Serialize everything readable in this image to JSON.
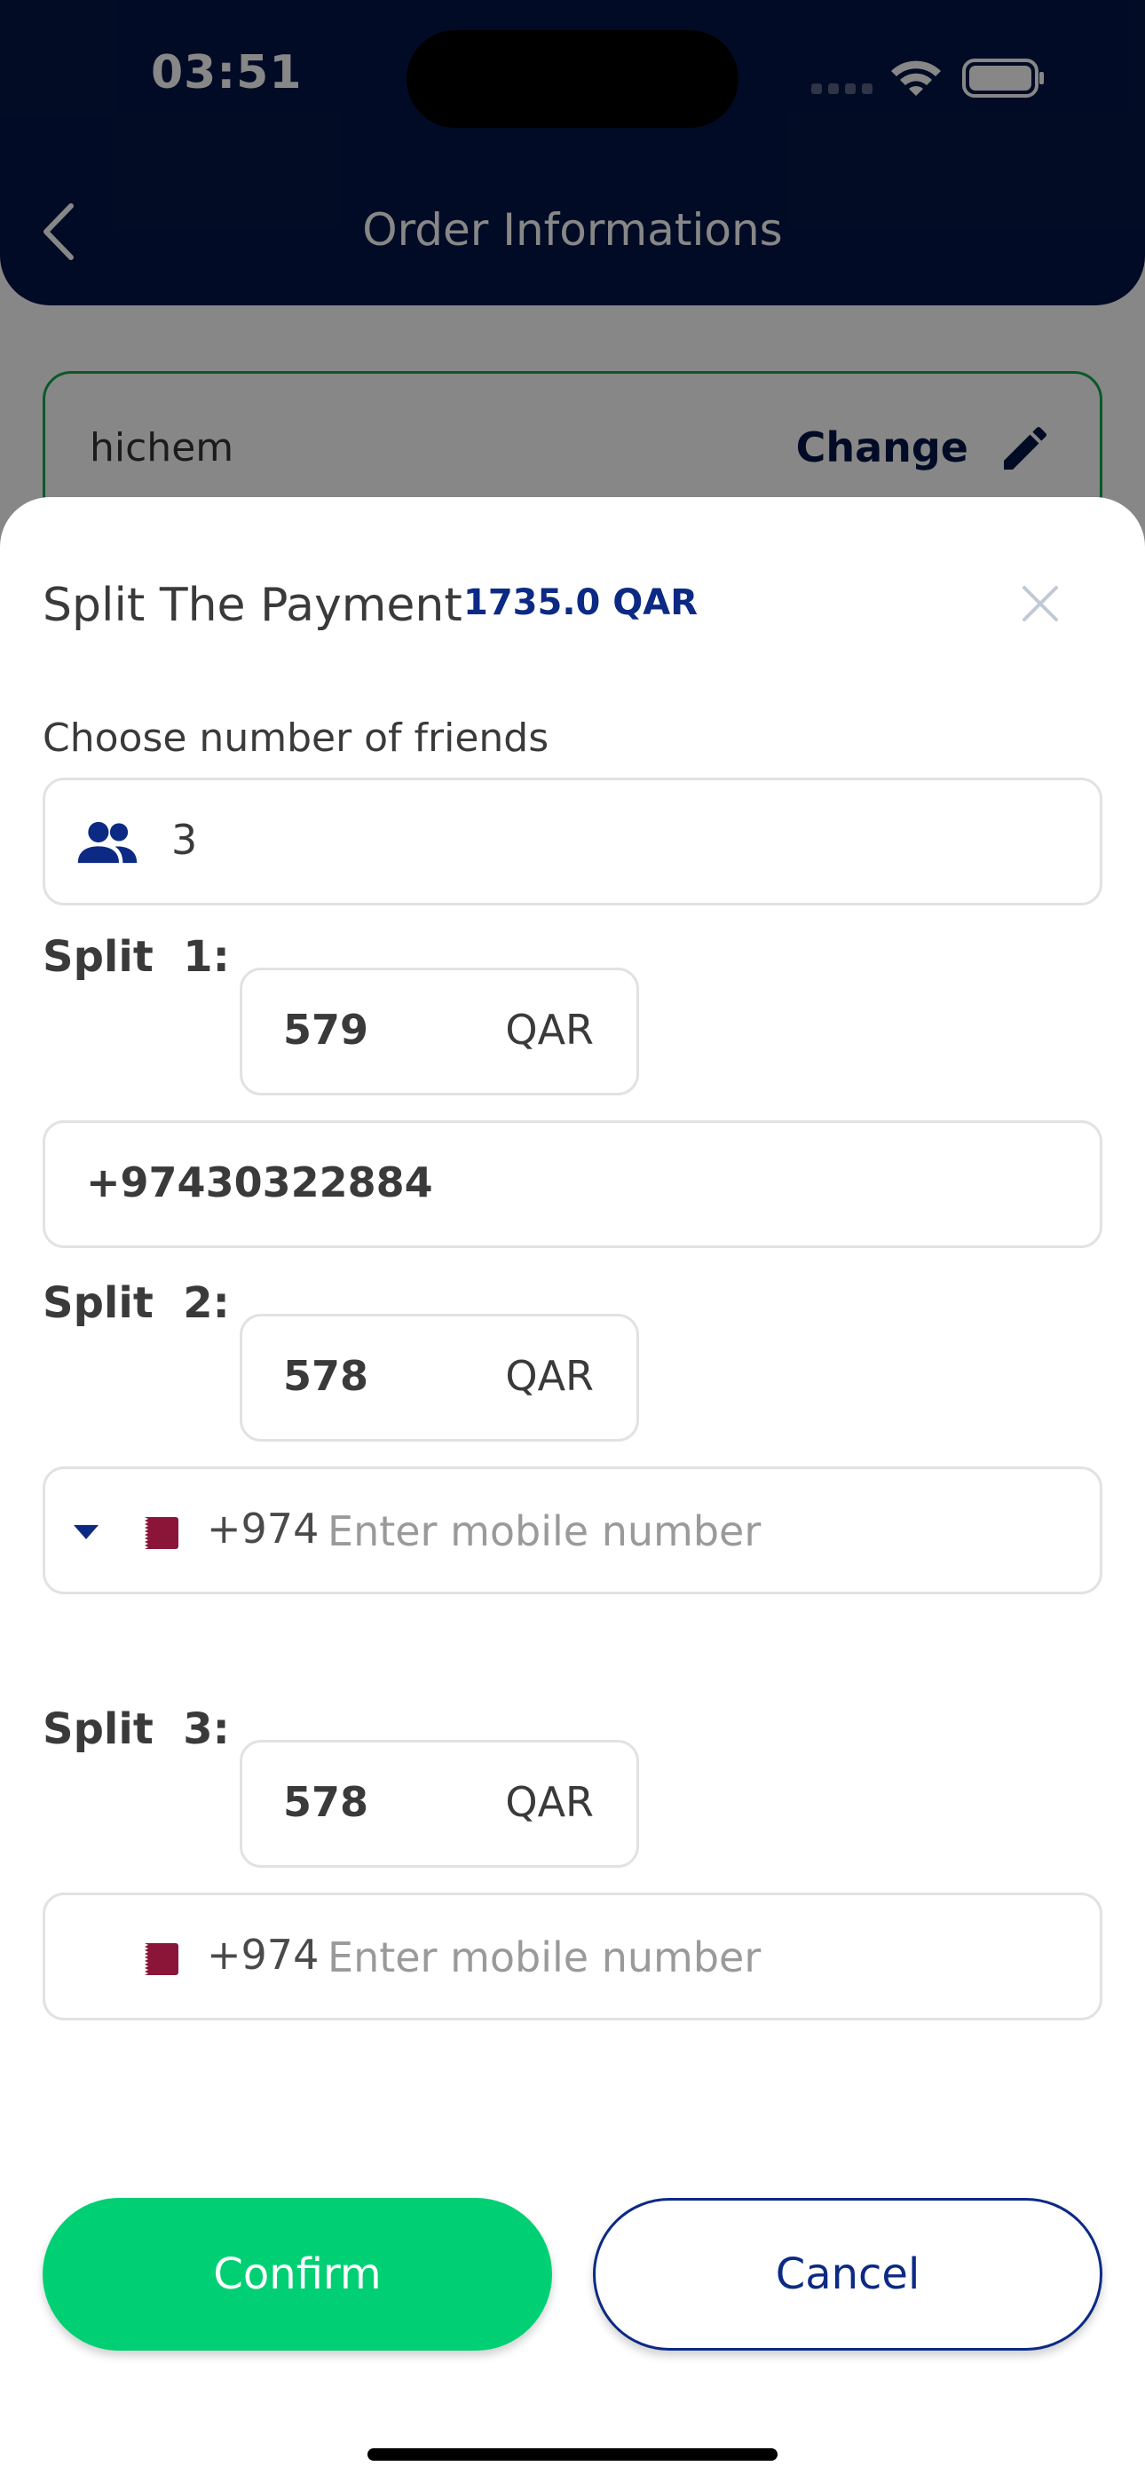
{
  "status_bar": {
    "time": "03:51"
  },
  "header": {
    "title": "Order Informations"
  },
  "customer": {
    "name": "hichem",
    "change_label": "Change"
  },
  "sheet": {
    "title": "Split The Payment",
    "total": "1735.0 QAR",
    "friends_label": "Choose number of friends",
    "friends_count": "3",
    "splits": [
      {
        "label": "Split  1:",
        "amount": "579",
        "currency": "QAR",
        "phone": "+97430322884"
      },
      {
        "label": "Split  2:",
        "amount": "578",
        "currency": "QAR",
        "dial_code": "+974",
        "phone_placeholder": "Enter mobile number"
      },
      {
        "label": "Split  3:",
        "amount": "578",
        "currency": "QAR",
        "dial_code": "+974",
        "phone_placeholder": "Enter mobile number"
      }
    ]
  },
  "buttons": {
    "confirm": "Confirm",
    "cancel": "Cancel"
  },
  "colors": {
    "header": "#041646",
    "accent_green": "#00d073",
    "accent_navy": "#0c2a84",
    "card_border": "#14a84a",
    "flag_maroon": "#8a1538"
  },
  "icons": [
    "back-chevron-icon",
    "pencil-icon",
    "close-icon",
    "people-icon",
    "caret-down-icon",
    "qatar-flag-icon",
    "wifi-icon",
    "battery-icon",
    "signal-icon"
  ]
}
